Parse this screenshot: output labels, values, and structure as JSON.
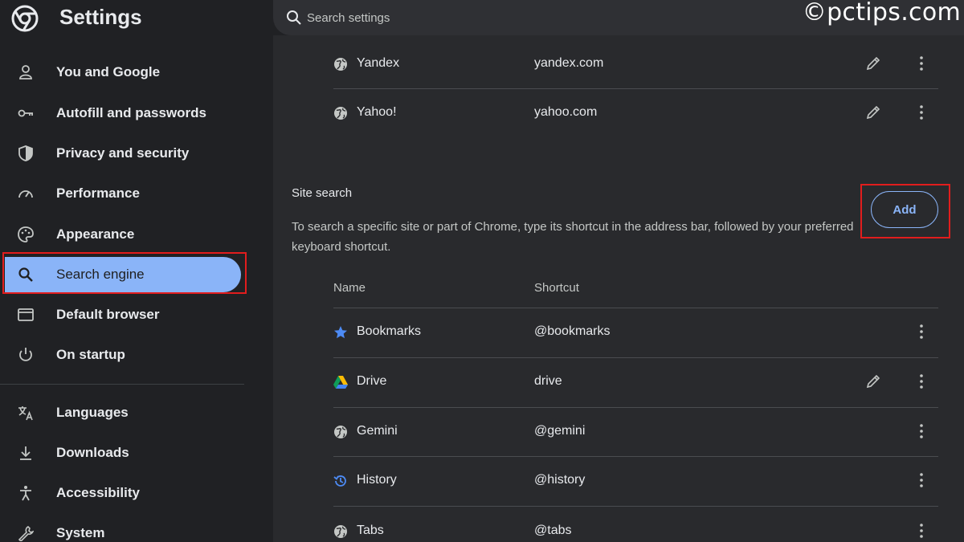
{
  "app": {
    "title": "Settings",
    "watermark": "©pctips.com"
  },
  "search": {
    "placeholder": "Search settings"
  },
  "sidebar": {
    "items": [
      {
        "label": "You and Google",
        "icon": "person-icon"
      },
      {
        "label": "Autofill and passwords",
        "icon": "key-icon"
      },
      {
        "label": "Privacy and security",
        "icon": "shield-icon"
      },
      {
        "label": "Performance",
        "icon": "speedometer-icon"
      },
      {
        "label": "Appearance",
        "icon": "palette-icon"
      },
      {
        "label": "Search engine",
        "icon": "search-icon",
        "active": true
      },
      {
        "label": "Default browser",
        "icon": "browser-window-icon"
      },
      {
        "label": "On startup",
        "icon": "power-icon"
      },
      {
        "label": "Languages",
        "icon": "translate-icon"
      },
      {
        "label": "Downloads",
        "icon": "download-icon"
      },
      {
        "label": "Accessibility",
        "icon": "accessibility-icon"
      },
      {
        "label": "System",
        "icon": "wrench-icon"
      }
    ]
  },
  "engines": [
    {
      "name": "Yandex",
      "shortcut": "yandex.com",
      "icon": "globe-icon"
    },
    {
      "name": "Yahoo!",
      "shortcut": "yahoo.com",
      "icon": "globe-icon"
    }
  ],
  "site_search": {
    "title": "Site search",
    "description": "To search a specific site or part of Chrome, type its shortcut in the address bar, followed by your preferred keyboard shortcut.",
    "add_label": "Add",
    "columns": {
      "name": "Name",
      "shortcut": "Shortcut"
    },
    "rows": [
      {
        "name": "Bookmarks",
        "shortcut": "@bookmarks",
        "icon": "star-icon"
      },
      {
        "name": "Drive",
        "shortcut": "drive",
        "icon": "drive-icon"
      },
      {
        "name": "Gemini",
        "shortcut": "@gemini",
        "icon": "globe-icon"
      },
      {
        "name": "History",
        "shortcut": "@history",
        "icon": "history-icon"
      },
      {
        "name": "Tabs",
        "shortcut": "@tabs",
        "icon": "globe-icon"
      }
    ]
  },
  "colors": {
    "accent": "#8ab4f8",
    "highlight_box": "#e11d1d",
    "background": "#202124",
    "panel": "#292a2d"
  }
}
